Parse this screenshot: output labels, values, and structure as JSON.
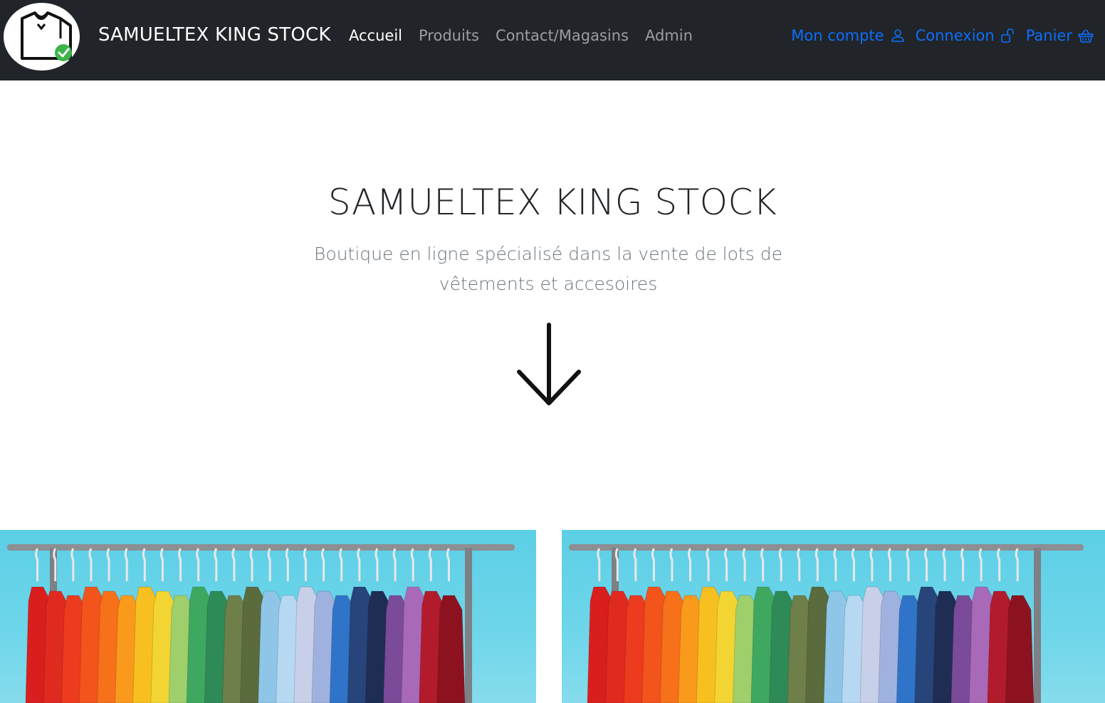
{
  "navbar": {
    "brand_name": "SAMUELTEX KING STOCK",
    "links": [
      {
        "label": "Accueil",
        "active": true
      },
      {
        "label": "Produits",
        "active": false
      },
      {
        "label": "Contact/Magasins",
        "active": false
      },
      {
        "label": "Admin",
        "active": false
      }
    ],
    "actions": [
      {
        "label": "Mon compte",
        "icon": "person-icon"
      },
      {
        "label": "Connexion",
        "icon": "unlock-icon"
      },
      {
        "label": "Panier",
        "icon": "basket-icon"
      }
    ]
  },
  "hero": {
    "title": "SAMUELTEX KING STOCK",
    "subtitle": "Boutique en ligne spécialisé dans la vente de lots de vêtements et accesoires",
    "arrow_icon": "arrow-down-icon"
  },
  "gallery": {
    "images": [
      {
        "subject": "clothing-rack-photo"
      },
      {
        "subject": "clothing-rack-photo"
      }
    ]
  },
  "colors": {
    "navbar_bg": "#212529",
    "link_accent": "#0d6efd",
    "image_bg": "#5ccfe6"
  }
}
